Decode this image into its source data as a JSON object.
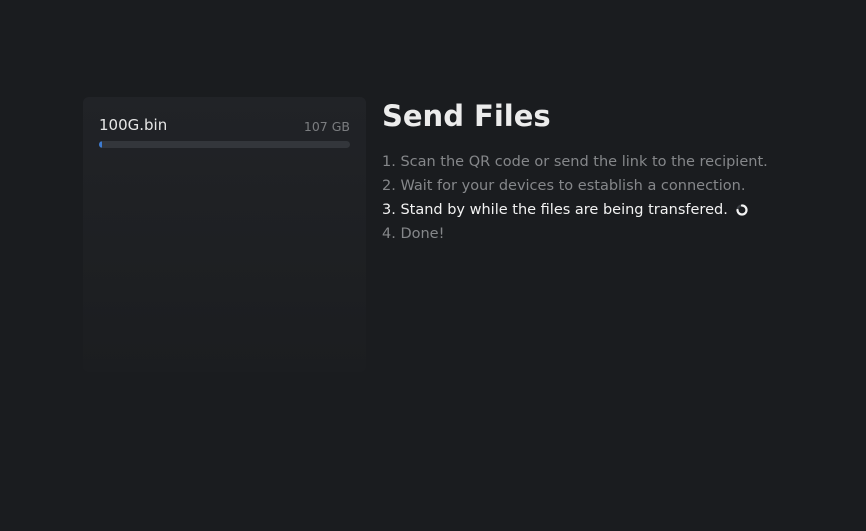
{
  "file_panel": {
    "files": [
      {
        "name": "100G.bin",
        "size": "107 GB",
        "progress": 0.01
      }
    ]
  },
  "main": {
    "title": "Send Files",
    "steps": [
      {
        "label": "1. Scan the QR code or send the link to the recipient.",
        "state": "done"
      },
      {
        "label": "2. Wait for your devices to establish a connection.",
        "state": "done"
      },
      {
        "label": "3. Stand by while the files are being transfered.",
        "state": "active"
      },
      {
        "label": "4. Done!",
        "state": "pending"
      }
    ],
    "active_icon": "spinner-icon"
  },
  "colors": {
    "background": "#1a1c1f",
    "panel": "#212327",
    "accent": "#3d7bd0",
    "text_active": "#f2f2f2",
    "text_muted": "#85878a"
  }
}
